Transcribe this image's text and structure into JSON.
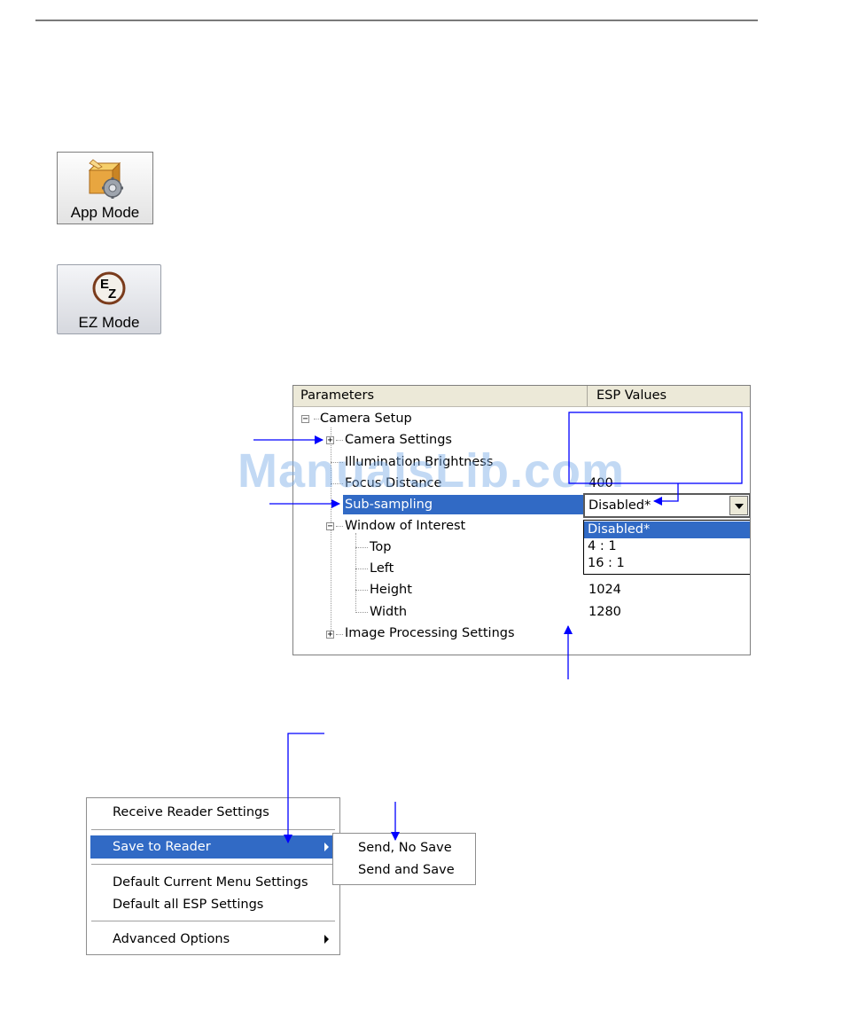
{
  "buttons": {
    "app_mode": "App Mode",
    "ez_mode": "EZ Mode"
  },
  "tree": {
    "columns": [
      "Parameters",
      "ESP Values"
    ],
    "rows": {
      "camera_setup": "Camera Setup",
      "camera_settings": "Camera Settings",
      "illumination": "Illumination Brightness",
      "focus_distance": "Focus Distance",
      "focus_value": "400",
      "sub_sampling": "Sub-sampling",
      "window_of_interest": "Window of Interest",
      "top": "Top",
      "left": "Left",
      "height": "Height",
      "height_value": "1024",
      "width": "Width",
      "width_value": "1280",
      "image_processing": "Image Processing Settings"
    },
    "combo_value": "Disabled*",
    "dropdown_options": [
      "Disabled*",
      "4 : 1",
      "16 : 1"
    ]
  },
  "menu": {
    "items": [
      "Receive Reader Settings",
      "Save to Reader",
      "Default Current Menu Settings",
      "Default all ESP Settings",
      "Advanced Options"
    ],
    "submenu": [
      "Send, No Save",
      "Send and Save"
    ]
  },
  "watermark": "ManualsLib.com",
  "colors": {
    "selection": "#316ac5",
    "callout_arrow": "#0000ff"
  }
}
